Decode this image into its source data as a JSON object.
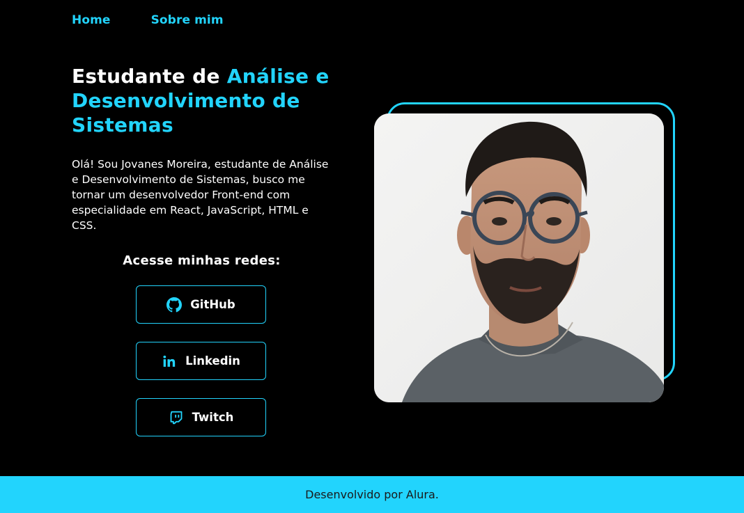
{
  "colors": {
    "background": "#000000",
    "accent": "#22D4FD",
    "text": "#FFFFFF",
    "footer_bg": "#22D4FD",
    "footer_text": "#1A1A1A"
  },
  "nav": {
    "items": [
      {
        "label": "Home"
      },
      {
        "label": "Sobre mim"
      }
    ]
  },
  "hero": {
    "title_plain": "Estudante de ",
    "title_accent": "Análise e Desenvolvimento de Sistemas",
    "description": "Olá! Sou Jovanes Moreira, estudante de Análise e Desenvolvimento de Sistemas, busco me tornar um desenvolvedor Front-end com especialidade em React, JavaScript, HTML e CSS.",
    "social_heading": "Acesse minhas redes:",
    "social_links": [
      {
        "label": "GitHub",
        "icon": "github-icon"
      },
      {
        "label": "Linkedin",
        "icon": "linkedin-icon"
      },
      {
        "label": "Twitch",
        "icon": "twitch-icon"
      }
    ],
    "photo_icon": "profile-photo"
  },
  "footer": {
    "text": "Desenvolvido por Alura."
  }
}
